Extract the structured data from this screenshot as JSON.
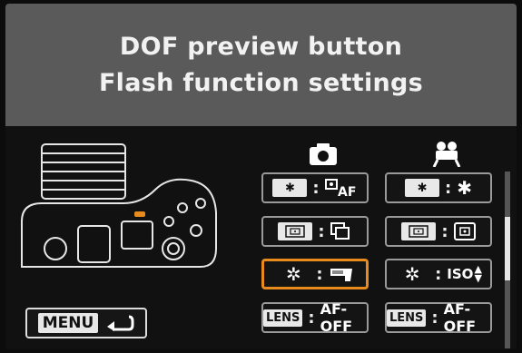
{
  "header": {
    "line1": "DOF preview button",
    "line2": "Flash function settings"
  },
  "menu_button": {
    "label": "MENU"
  },
  "columns": {
    "still_icon": "camera-icon",
    "movie_icon": "movie-camera-icon"
  },
  "options": [
    {
      "id": "still-1",
      "key_icon": "ae-lock-icon",
      "function_icon": "af-start-icon"
    },
    {
      "id": "movie-1",
      "key_icon": "ae-lock-icon",
      "function_icon": "ae-lock-icon"
    },
    {
      "id": "still-2",
      "key_icon": "metering-icon",
      "function_icon": "drive-mode-icon"
    },
    {
      "id": "movie-2",
      "key_icon": "metering-icon",
      "function_icon": "metering-mode-icon"
    },
    {
      "id": "still-3",
      "key_icon": "aperture-icon",
      "function_icon": "flash-function-icon",
      "selected": true
    },
    {
      "id": "movie-3",
      "key_icon": "aperture-icon",
      "function_icon": "iso-icon",
      "function_text": "ISO"
    },
    {
      "id": "still-4",
      "key_text": "LENS",
      "function_text": "AF-OFF"
    },
    {
      "id": "movie-4",
      "key_text": "LENS",
      "function_text": "AF-OFF"
    }
  ],
  "colors": {
    "selection": "#e88a1c",
    "header_bg": "#5a5a5a"
  }
}
